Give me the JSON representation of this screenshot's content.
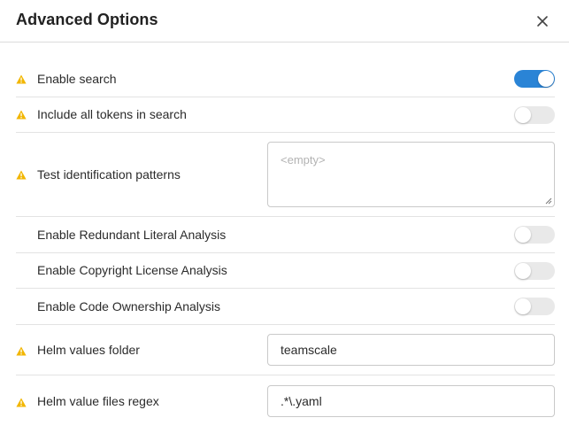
{
  "dialog": {
    "title": "Advanced Options",
    "close_icon": "close-icon"
  },
  "options": {
    "enable_search": {
      "label": "Enable search",
      "checked": true,
      "warning": true
    },
    "include_all_tokens": {
      "label": "Include all tokens in search",
      "checked": false,
      "warning": true
    },
    "test_patterns": {
      "label": "Test identification patterns",
      "value": "",
      "placeholder": "<empty>",
      "warning": true
    },
    "redundant_literal": {
      "label": "Enable Redundant Literal Analysis",
      "checked": false,
      "warning": false
    },
    "copyright_license": {
      "label": "Enable Copyright License Analysis",
      "checked": false,
      "warning": false
    },
    "code_ownership": {
      "label": "Enable Code Ownership Analysis",
      "checked": false,
      "warning": false
    },
    "helm_values_folder": {
      "label": "Helm values folder",
      "value": "teamscale",
      "warning": true
    },
    "helm_value_files_regex": {
      "label": "Helm value files regex",
      "value": ".*\\.yaml",
      "warning": true
    }
  },
  "colors": {
    "accent": "#2a84d6",
    "warning": "#f2b600",
    "toggle_off": "#e9e9e9"
  }
}
